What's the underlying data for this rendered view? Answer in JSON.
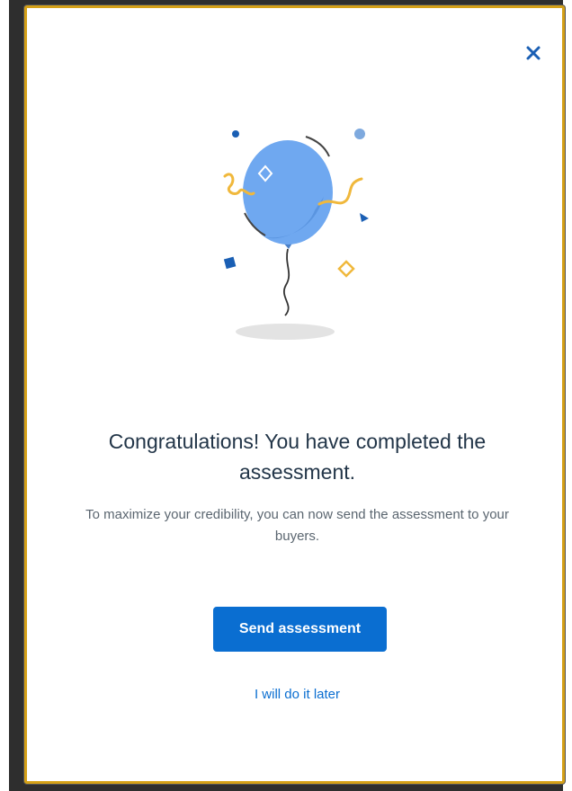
{
  "dialog": {
    "close_icon": "close-icon",
    "illustration_icon": "balloon-celebration-illustration",
    "title": "Congratulations! You have completed the assessment.",
    "message": "To maximize your credibility, you can now send the assessment to your buyers.",
    "primary_button_label": "Send assessment",
    "secondary_link_label": "I will do it later"
  },
  "colors": {
    "accent": "#0a6ed1",
    "balloon": "#6fa8f0",
    "confetti_yellow": "#f0b83c",
    "confetti_blue": "#1a5fb4",
    "modal_border": "#d4a017"
  }
}
